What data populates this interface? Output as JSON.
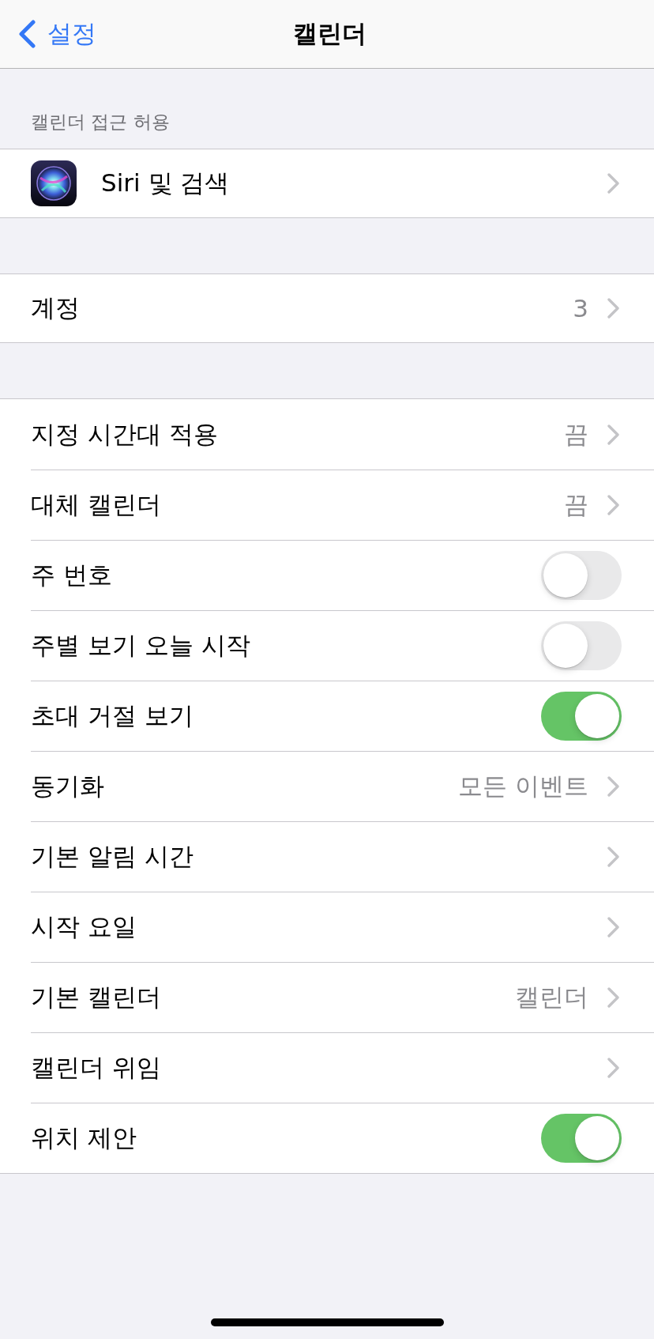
{
  "nav_bar": {
    "back_label": "설정",
    "title": "캘린더"
  },
  "sections": [
    {
      "header": "캘린더 접근 허용",
      "rows": [
        {
          "kind": "app_link",
          "label": "Siri 및 검색"
        }
      ]
    },
    {
      "rows": [
        {
          "kind": "link",
          "label": "계정",
          "value": "3"
        }
      ]
    },
    {
      "rows": [
        {
          "kind": "link",
          "label": "지정 시간대 적용",
          "value": "끔"
        },
        {
          "kind": "link",
          "label": "대체 캘린더",
          "value": "끔"
        },
        {
          "kind": "toggle",
          "label": "주 번호",
          "on": false
        },
        {
          "kind": "toggle",
          "label": "주별 보기 오늘 시작",
          "on": false
        },
        {
          "kind": "toggle",
          "label": "초대 거절 보기",
          "on": true
        },
        {
          "kind": "link",
          "label": "동기화",
          "value": "모든 이벤트"
        },
        {
          "kind": "link",
          "label": "기본 알림 시간"
        },
        {
          "kind": "link",
          "label": "시작 요일"
        },
        {
          "kind": "link",
          "label": "기본 캘린더",
          "value": "캘린더"
        },
        {
          "kind": "link",
          "label": "캘린더 위임"
        },
        {
          "kind": "toggle",
          "label": "위치 제안",
          "on": true
        }
      ]
    }
  ]
}
